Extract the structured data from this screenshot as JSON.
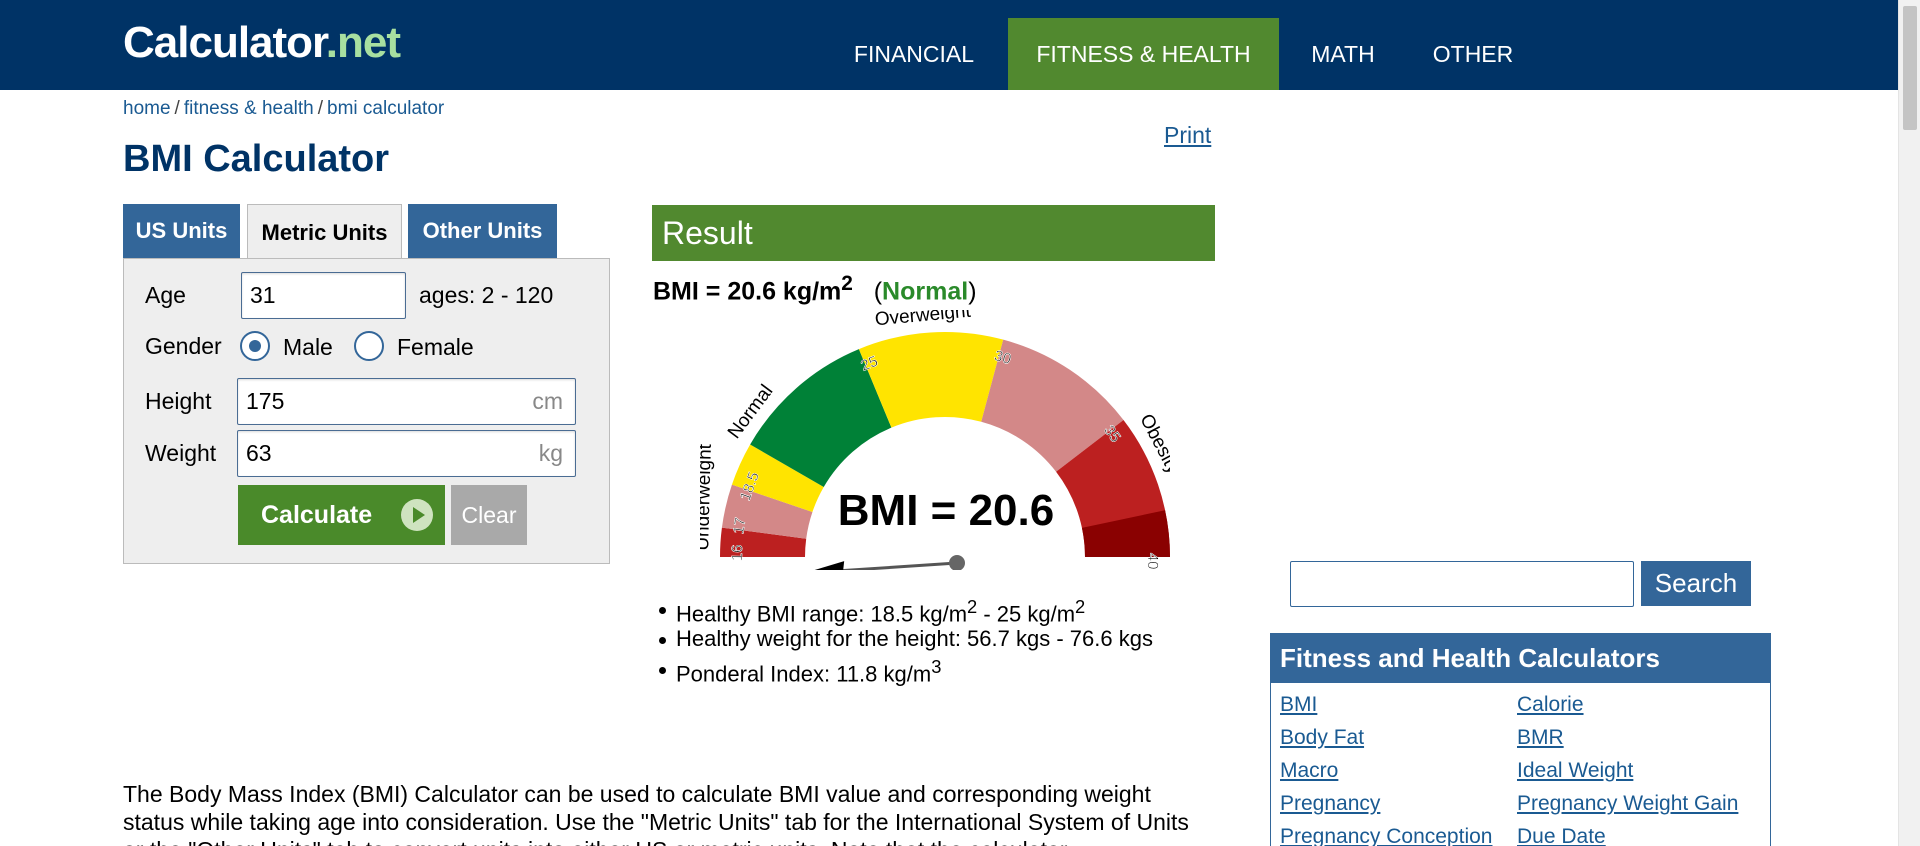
{
  "header": {
    "logo_main": "Calculator",
    "logo_tld": ".net",
    "nav": [
      "FINANCIAL",
      "FITNESS & HEALTH",
      "MATH",
      "OTHER"
    ]
  },
  "breadcrumb": [
    "home",
    "fitness & health",
    "bmi calculator"
  ],
  "print_label": "Print",
  "page_title": "BMI Calculator",
  "tabs": [
    "US Units",
    "Metric Units",
    "Other Units"
  ],
  "form": {
    "age_label": "Age",
    "age_value": "31",
    "age_hint": "ages: 2 - 120",
    "gender_label": "Gender",
    "gender_male": "Male",
    "gender_female": "Female",
    "height_label": "Height",
    "height_value": "175",
    "height_unit": "cm",
    "weight_label": "Weight",
    "weight_value": "63",
    "weight_unit": "kg",
    "calculate_label": "Calculate",
    "clear_label": "Clear"
  },
  "result": {
    "heading": "Result",
    "bmi_text": "BMI = 20.6 kg/m",
    "bmi_sup": "2",
    "status_open": "(",
    "status": "Normal",
    "status_close": ")",
    "gauge_value_text": "BMI = 20.6",
    "gauge": {
      "bmi": 20.6,
      "min": 16,
      "max": 40,
      "categories": [
        "Underweight",
        "Normal",
        "Overweight",
        "Obesity"
      ],
      "tick_labels": [
        "16",
        "17",
        "18.5",
        "25",
        "30",
        "35",
        "40"
      ],
      "colors": {
        "severe": "#bc2020",
        "moderate": "#d38888",
        "mild": "#ffe400",
        "normal": "#008137",
        "dark": "#8a0101"
      }
    },
    "stats": [
      {
        "text": "Healthy BMI range: 18.5 kg/m",
        "sup": "2",
        "text2": " - 25 kg/m",
        "sup2": "2"
      },
      {
        "text": "Healthy weight for the height: 56.7 kgs - 76.6 kgs"
      },
      {
        "text": "Ponderal Index: 11.8 kg/m",
        "sup": "3"
      }
    ]
  },
  "description": "The Body Mass Index (BMI) Calculator can be used to calculate BMI value and corresponding weight status while taking age into consideration. Use the \"Metric Units\" tab for the International System of Units or the \"Other Units\" tab to convert units into either US or metric units. Note that the calculator",
  "sidebar": {
    "search_label": "Search",
    "box_title": "Fitness and Health Calculators",
    "links_left": [
      "BMI",
      "Body Fat",
      "Macro",
      "Pregnancy",
      "Pregnancy Conception"
    ],
    "links_right": [
      "Calorie",
      "BMR",
      "Ideal Weight",
      "Pregnancy Weight Gain",
      "Due Date"
    ]
  }
}
